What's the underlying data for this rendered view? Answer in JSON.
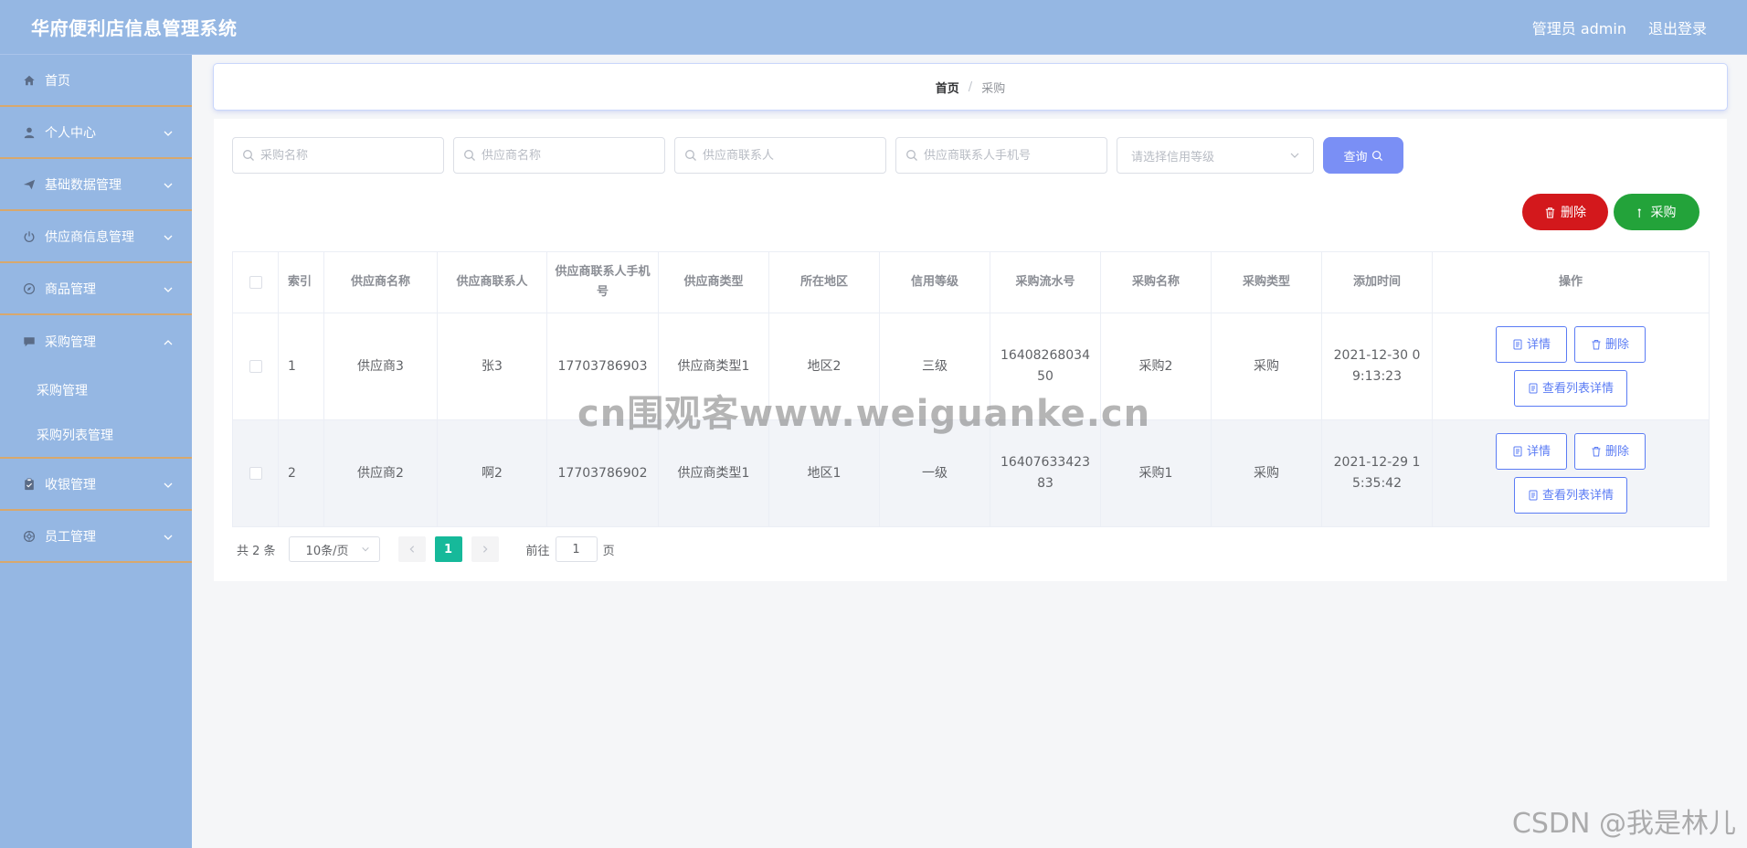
{
  "header": {
    "title": "华府便利店信息管理系统",
    "user": "管理员 admin",
    "logout": "退出登录"
  },
  "sidebar": {
    "items": [
      {
        "label": "首页",
        "icon": "home-icon"
      },
      {
        "label": "个人中心",
        "icon": "user-icon"
      },
      {
        "label": "基础数据管理",
        "icon": "send-icon"
      },
      {
        "label": "供应商信息管理",
        "icon": "power-icon"
      },
      {
        "label": "商品管理",
        "icon": "compass-icon"
      },
      {
        "label": "采购管理",
        "icon": "chat-icon"
      },
      {
        "label": "收银管理",
        "icon": "clipboard-icon"
      },
      {
        "label": "员工管理",
        "icon": "aperture-icon"
      }
    ],
    "sub": [
      "采购管理",
      "采购列表管理"
    ]
  },
  "breadcrumb": {
    "home": "首页",
    "sep": "/",
    "current": "采购"
  },
  "search": {
    "name_placeholder": "采购名称",
    "supplier_placeholder": "供应商名称",
    "contact_placeholder": "供应商联系人",
    "phone_placeholder": "供应商联系人手机号",
    "credit_placeholder": "请选择信用等级",
    "query_label": "查询"
  },
  "actions": {
    "delete_label": "删除",
    "purchase_label": "采购"
  },
  "table": {
    "headers": [
      "索引",
      "供应商名称",
      "供应商联系人",
      "供应商联系人手机号",
      "供应商类型",
      "所在地区",
      "信用等级",
      "采购流水号",
      "采购名称",
      "采购类型",
      "添加时间",
      "操作"
    ],
    "rows": [
      {
        "index": "1",
        "supplier": "供应商3",
        "contact": "张3",
        "phone": "17703786903",
        "type": "供应商类型1",
        "region": "地区2",
        "credit": "三级",
        "serial": "1640826803450",
        "name": "采购2",
        "ptype": "采购",
        "time": "2021-12-30 09:13:23"
      },
      {
        "index": "2",
        "supplier": "供应商2",
        "contact": "啊2",
        "phone": "17703786902",
        "type": "供应商类型1",
        "region": "地区1",
        "credit": "一级",
        "serial": "1640763342383",
        "name": "采购1",
        "ptype": "采购",
        "time": "2021-12-29 15:35:42"
      }
    ],
    "ops": {
      "detail": "详情",
      "delete": "删除",
      "list_detail": "查看列表详情"
    }
  },
  "pagination": {
    "total": "共 2 条",
    "page_size": "10条/页",
    "current_page": "1",
    "goto_prefix": "前往",
    "goto_value": "1",
    "goto_suffix": "页"
  },
  "watermarks": {
    "center": "cn围观客www.weiguanke.cn",
    "corner": "CSDN @我是林儿"
  },
  "colors": {
    "header_bg": "#95b7e3",
    "sidebar_divider": "#d7a86e",
    "query_button": "#7a8ff5",
    "delete_button": "#d3181c",
    "purchase_button": "#23a33a",
    "op_button": "#5b7cf4",
    "page_active": "#16b99a"
  }
}
